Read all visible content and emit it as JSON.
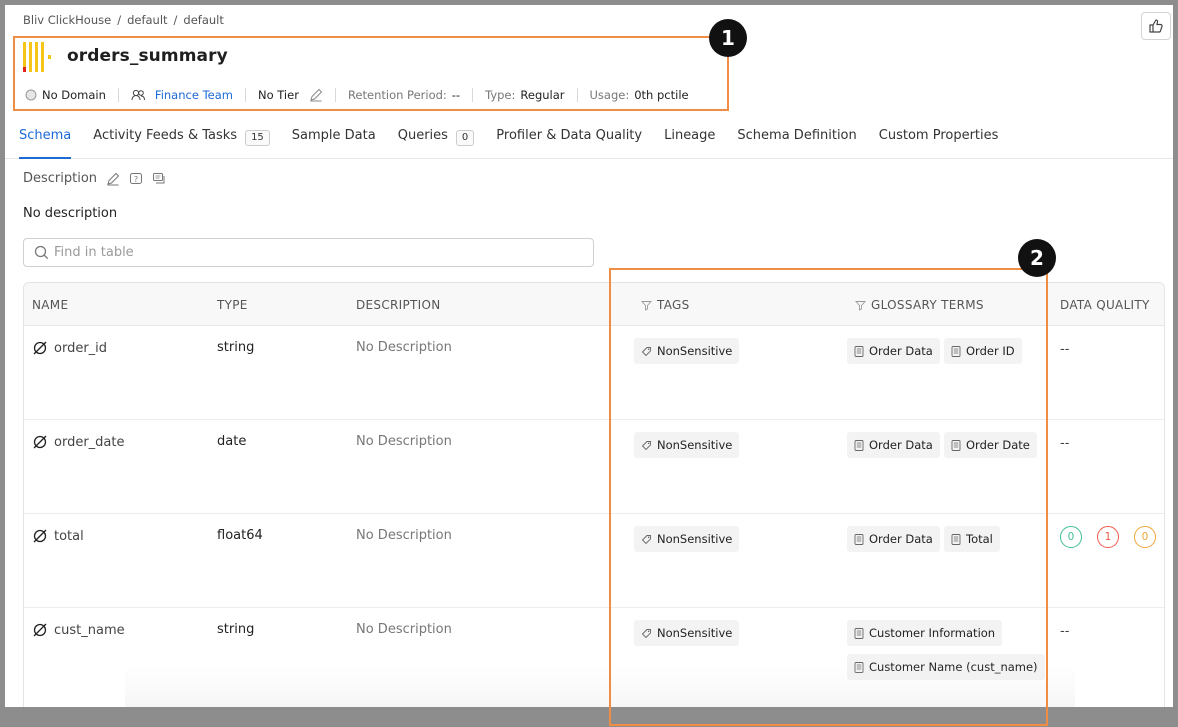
{
  "breadcrumb": [
    "Bliv ClickHouse",
    "default",
    "default"
  ],
  "entity": {
    "name": "orders_summary",
    "domain": "No Domain",
    "owner": "Finance Team",
    "tier": "No Tier",
    "retention_label": "Retention Period:",
    "retention_value": "--",
    "type_label": "Type:",
    "type_value": "Regular",
    "usage_label": "Usage:",
    "usage_value": "0th pctile"
  },
  "callouts": [
    "1",
    "2"
  ],
  "tabs": [
    {
      "label": "Schema",
      "active": true
    },
    {
      "label": "Activity Feeds & Tasks",
      "count": "15"
    },
    {
      "label": "Sample Data"
    },
    {
      "label": "Queries",
      "count": "0"
    },
    {
      "label": "Profiler & Data Quality"
    },
    {
      "label": "Lineage"
    },
    {
      "label": "Schema Definition"
    },
    {
      "label": "Custom Properties"
    }
  ],
  "description": {
    "label": "Description",
    "value": "No description"
  },
  "search": {
    "placeholder": "Find in table"
  },
  "table": {
    "headers": {
      "name": "NAME",
      "type": "TYPE",
      "description": "DESCRIPTION",
      "tags": "TAGS",
      "glossary": "GLOSSARY TERMS",
      "quality": "DATA QUALITY"
    },
    "rows": [
      {
        "name": "order_id",
        "type": "string",
        "description": "No Description",
        "tag": "NonSensitive",
        "terms": [
          "Order Data",
          "Order ID"
        ],
        "quality": "--"
      },
      {
        "name": "order_date",
        "type": "date",
        "description": "No Description",
        "tag": "NonSensitive",
        "terms": [
          "Order Data",
          "Order Date"
        ],
        "quality": "--"
      },
      {
        "name": "total",
        "type": "float64",
        "description": "No Description",
        "tag": "NonSensitive",
        "terms": [
          "Order Data",
          "Total"
        ],
        "quality_counts": [
          "0",
          "1",
          "0"
        ]
      },
      {
        "name": "cust_name",
        "type": "string",
        "description": "No Description",
        "tag": "NonSensitive",
        "terms": [
          "Customer Information",
          "Customer Name (cust_name)"
        ],
        "quality": "--"
      }
    ]
  },
  "colors": {
    "accent": "#1d6ad6",
    "highlight": "#ef8d45",
    "logo_yellow": "#f5c518",
    "logo_red": "#e0251b",
    "dq_success": "#3fbf8f",
    "dq_failed": "#ef5a4a",
    "dq_aborted": "#f0a63a"
  },
  "icons": [
    "thumbs-up-icon",
    "clickhouse-logo-icon",
    "domain-icon",
    "owner-icon",
    "edit-icon",
    "request-description-icon",
    "conversation-icon",
    "search-icon",
    "filter-icon",
    "column-type-icon",
    "tag-icon",
    "glossary-icon"
  ]
}
